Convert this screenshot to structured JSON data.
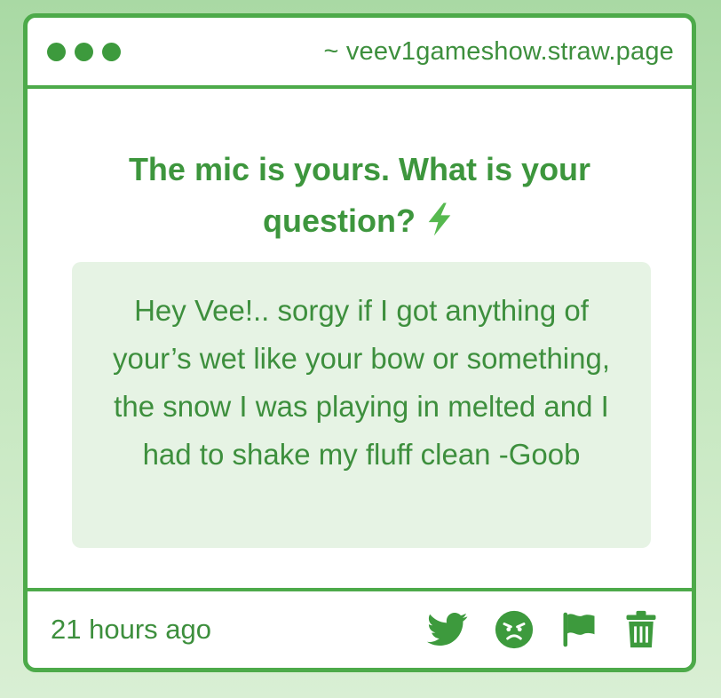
{
  "window": {
    "url": "~ veev1gameshow.straw.page"
  },
  "prompt": {
    "question": "The mic is yours. What is your question?",
    "icon": "lightning-bolt-icon"
  },
  "message": {
    "text": "Hey Vee!.. sorgy if I got anything of your’s wet like your bow or something, the snow I was playing in melted and I had to shake my fluff clean -Goob"
  },
  "footer": {
    "timestamp": "21 hours ago",
    "actions": [
      "twitter-icon",
      "angry-face-icon",
      "flag-icon",
      "trash-icon"
    ]
  },
  "colors": {
    "accent": "#4daa4a",
    "text": "#3d8f3d",
    "answer_bg": "#e6f3e4"
  }
}
